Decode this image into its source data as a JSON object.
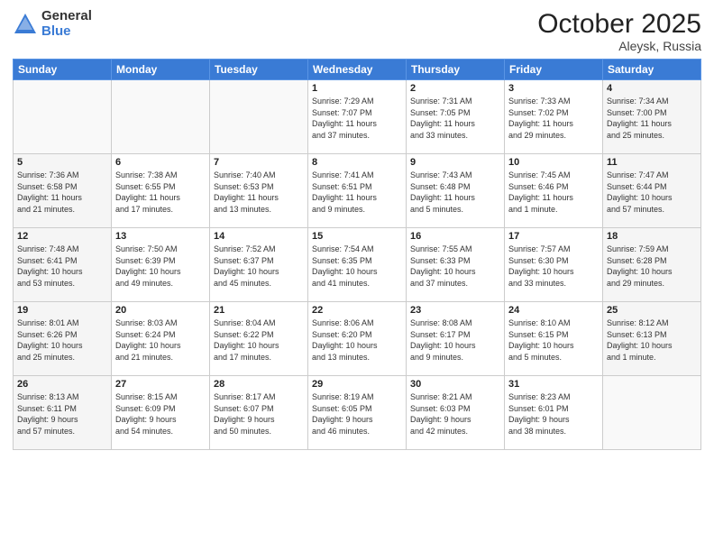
{
  "header": {
    "logo_general": "General",
    "logo_blue": "Blue",
    "month": "October 2025",
    "location": "Aleysk, Russia"
  },
  "weekdays": [
    "Sunday",
    "Monday",
    "Tuesday",
    "Wednesday",
    "Thursday",
    "Friday",
    "Saturday"
  ],
  "weeks": [
    [
      {
        "day": "",
        "info": ""
      },
      {
        "day": "",
        "info": ""
      },
      {
        "day": "",
        "info": ""
      },
      {
        "day": "1",
        "info": "Sunrise: 7:29 AM\nSunset: 7:07 PM\nDaylight: 11 hours\nand 37 minutes."
      },
      {
        "day": "2",
        "info": "Sunrise: 7:31 AM\nSunset: 7:05 PM\nDaylight: 11 hours\nand 33 minutes."
      },
      {
        "day": "3",
        "info": "Sunrise: 7:33 AM\nSunset: 7:02 PM\nDaylight: 11 hours\nand 29 minutes."
      },
      {
        "day": "4",
        "info": "Sunrise: 7:34 AM\nSunset: 7:00 PM\nDaylight: 11 hours\nand 25 minutes."
      }
    ],
    [
      {
        "day": "5",
        "info": "Sunrise: 7:36 AM\nSunset: 6:58 PM\nDaylight: 11 hours\nand 21 minutes."
      },
      {
        "day": "6",
        "info": "Sunrise: 7:38 AM\nSunset: 6:55 PM\nDaylight: 11 hours\nand 17 minutes."
      },
      {
        "day": "7",
        "info": "Sunrise: 7:40 AM\nSunset: 6:53 PM\nDaylight: 11 hours\nand 13 minutes."
      },
      {
        "day": "8",
        "info": "Sunrise: 7:41 AM\nSunset: 6:51 PM\nDaylight: 11 hours\nand 9 minutes."
      },
      {
        "day": "9",
        "info": "Sunrise: 7:43 AM\nSunset: 6:48 PM\nDaylight: 11 hours\nand 5 minutes."
      },
      {
        "day": "10",
        "info": "Sunrise: 7:45 AM\nSunset: 6:46 PM\nDaylight: 11 hours\nand 1 minute."
      },
      {
        "day": "11",
        "info": "Sunrise: 7:47 AM\nSunset: 6:44 PM\nDaylight: 10 hours\nand 57 minutes."
      }
    ],
    [
      {
        "day": "12",
        "info": "Sunrise: 7:48 AM\nSunset: 6:41 PM\nDaylight: 10 hours\nand 53 minutes."
      },
      {
        "day": "13",
        "info": "Sunrise: 7:50 AM\nSunset: 6:39 PM\nDaylight: 10 hours\nand 49 minutes."
      },
      {
        "day": "14",
        "info": "Sunrise: 7:52 AM\nSunset: 6:37 PM\nDaylight: 10 hours\nand 45 minutes."
      },
      {
        "day": "15",
        "info": "Sunrise: 7:54 AM\nSunset: 6:35 PM\nDaylight: 10 hours\nand 41 minutes."
      },
      {
        "day": "16",
        "info": "Sunrise: 7:55 AM\nSunset: 6:33 PM\nDaylight: 10 hours\nand 37 minutes."
      },
      {
        "day": "17",
        "info": "Sunrise: 7:57 AM\nSunset: 6:30 PM\nDaylight: 10 hours\nand 33 minutes."
      },
      {
        "day": "18",
        "info": "Sunrise: 7:59 AM\nSunset: 6:28 PM\nDaylight: 10 hours\nand 29 minutes."
      }
    ],
    [
      {
        "day": "19",
        "info": "Sunrise: 8:01 AM\nSunset: 6:26 PM\nDaylight: 10 hours\nand 25 minutes."
      },
      {
        "day": "20",
        "info": "Sunrise: 8:03 AM\nSunset: 6:24 PM\nDaylight: 10 hours\nand 21 minutes."
      },
      {
        "day": "21",
        "info": "Sunrise: 8:04 AM\nSunset: 6:22 PM\nDaylight: 10 hours\nand 17 minutes."
      },
      {
        "day": "22",
        "info": "Sunrise: 8:06 AM\nSunset: 6:20 PM\nDaylight: 10 hours\nand 13 minutes."
      },
      {
        "day": "23",
        "info": "Sunrise: 8:08 AM\nSunset: 6:17 PM\nDaylight: 10 hours\nand 9 minutes."
      },
      {
        "day": "24",
        "info": "Sunrise: 8:10 AM\nSunset: 6:15 PM\nDaylight: 10 hours\nand 5 minutes."
      },
      {
        "day": "25",
        "info": "Sunrise: 8:12 AM\nSunset: 6:13 PM\nDaylight: 10 hours\nand 1 minute."
      }
    ],
    [
      {
        "day": "26",
        "info": "Sunrise: 8:13 AM\nSunset: 6:11 PM\nDaylight: 9 hours\nand 57 minutes."
      },
      {
        "day": "27",
        "info": "Sunrise: 8:15 AM\nSunset: 6:09 PM\nDaylight: 9 hours\nand 54 minutes."
      },
      {
        "day": "28",
        "info": "Sunrise: 8:17 AM\nSunset: 6:07 PM\nDaylight: 9 hours\nand 50 minutes."
      },
      {
        "day": "29",
        "info": "Sunrise: 8:19 AM\nSunset: 6:05 PM\nDaylight: 9 hours\nand 46 minutes."
      },
      {
        "day": "30",
        "info": "Sunrise: 8:21 AM\nSunset: 6:03 PM\nDaylight: 9 hours\nand 42 minutes."
      },
      {
        "day": "31",
        "info": "Sunrise: 8:23 AM\nSunset: 6:01 PM\nDaylight: 9 hours\nand 38 minutes."
      },
      {
        "day": "",
        "info": ""
      }
    ]
  ]
}
